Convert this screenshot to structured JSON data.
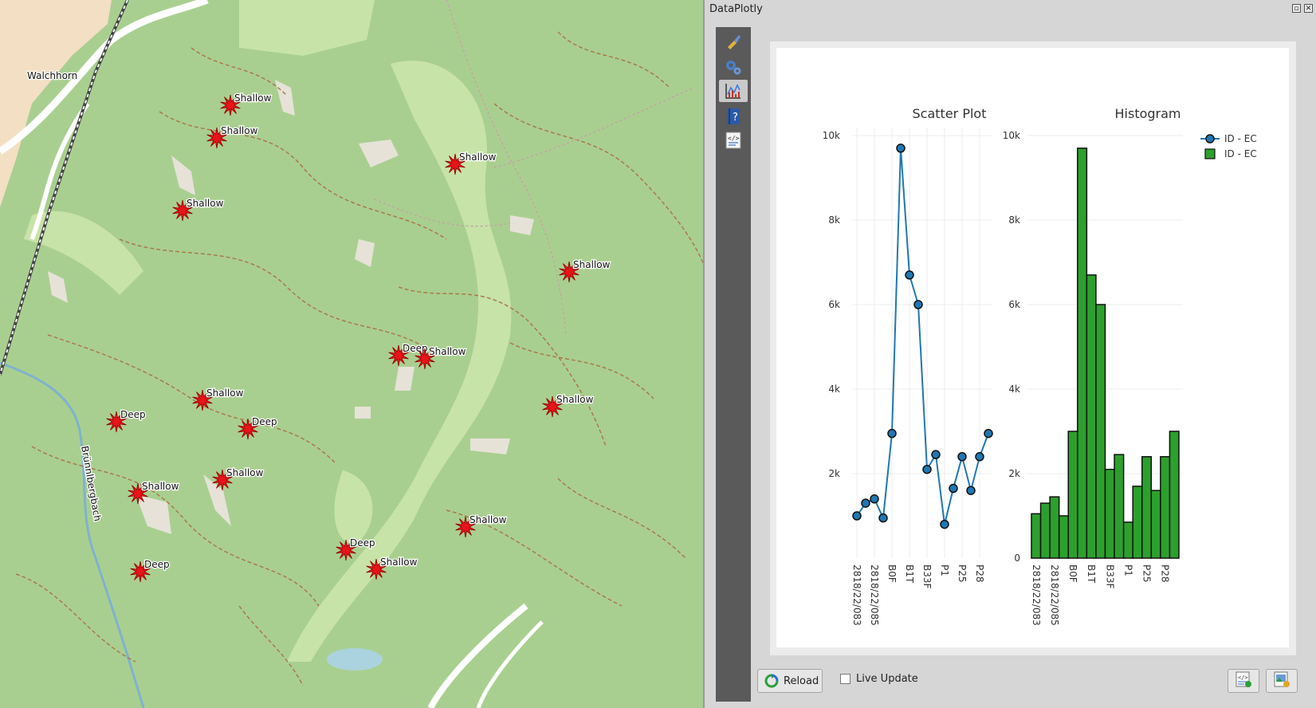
{
  "map": {
    "place_label": "Walchhorn",
    "river_label": "Brünnlbergbach",
    "marker_color": "#e8141a",
    "markers": [
      {
        "label": "Shallow"
      },
      {
        "label": "Shallow"
      },
      {
        "label": "Shallow"
      },
      {
        "label": "Shallow"
      },
      {
        "label": "Shallow"
      },
      {
        "label": "Deep"
      },
      {
        "label": "Shallow"
      },
      {
        "label": "Shallow"
      },
      {
        "label": "Shallow"
      },
      {
        "label": "Deep"
      },
      {
        "label": "Deep"
      },
      {
        "label": "Shallow"
      },
      {
        "label": "Shallow"
      },
      {
        "label": "Deep"
      },
      {
        "label": "Shallow"
      },
      {
        "label": "Shallow"
      },
      {
        "label": "Deep"
      }
    ]
  },
  "panel": {
    "title": "DataPlotly",
    "toolbar_icons": [
      "brush-icon",
      "gears-icon",
      "plot-icon",
      "help-icon",
      "code-icon"
    ],
    "reload_label": "Reload",
    "live_update_label": "Live Update",
    "live_update_checked": false,
    "export_icons": [
      "export-html-icon",
      "export-image-icon"
    ]
  },
  "chart_data": [
    {
      "type": "line",
      "title": "Scatter Plot",
      "xlabel": "",
      "ylabel": "",
      "ylim": [
        0,
        10000
      ],
      "y_ticks": [
        "2k",
        "4k",
        "6k",
        "8k",
        "10k"
      ],
      "x_tick_labels": [
        "2818/22/083",
        "2818/22/085",
        "B0F",
        "B1T",
        "B33F",
        "P1",
        "P25",
        "P28"
      ],
      "grid": true,
      "color": "#1f77b4",
      "marker_color": "#1f77b4",
      "series": [
        {
          "name": "ID - EC",
          "values": [
            1000,
            1300,
            1400,
            950,
            2950,
            9700,
            6700,
            6000,
            2100,
            2450,
            800,
            1650,
            2400,
            1600,
            2400,
            2950
          ]
        }
      ]
    },
    {
      "type": "bar",
      "title": "Histogram",
      "xlabel": "",
      "ylabel": "",
      "ylim": [
        0,
        10000
      ],
      "y_ticks": [
        "0",
        "2k",
        "4k",
        "6k",
        "8k",
        "10k"
      ],
      "x_tick_labels": [
        "2818/22/083",
        "2818/22/085",
        "B0F",
        "B1T",
        "B33F",
        "P1",
        "P25",
        "P28"
      ],
      "grid": true,
      "color": "#2ca02c",
      "series": [
        {
          "name": "ID - EC",
          "values": [
            1050,
            1300,
            1450,
            1000,
            3000,
            9700,
            6700,
            6000,
            2100,
            2450,
            850,
            1700,
            2400,
            1600,
            2400,
            3000
          ]
        }
      ]
    }
  ],
  "legend": {
    "placement": "top-right",
    "items": [
      {
        "label": "ID - EC",
        "kind": "line-marker",
        "color": "#1f77b4"
      },
      {
        "label": "ID - EC",
        "kind": "bar",
        "color": "#2ca02c"
      }
    ]
  }
}
